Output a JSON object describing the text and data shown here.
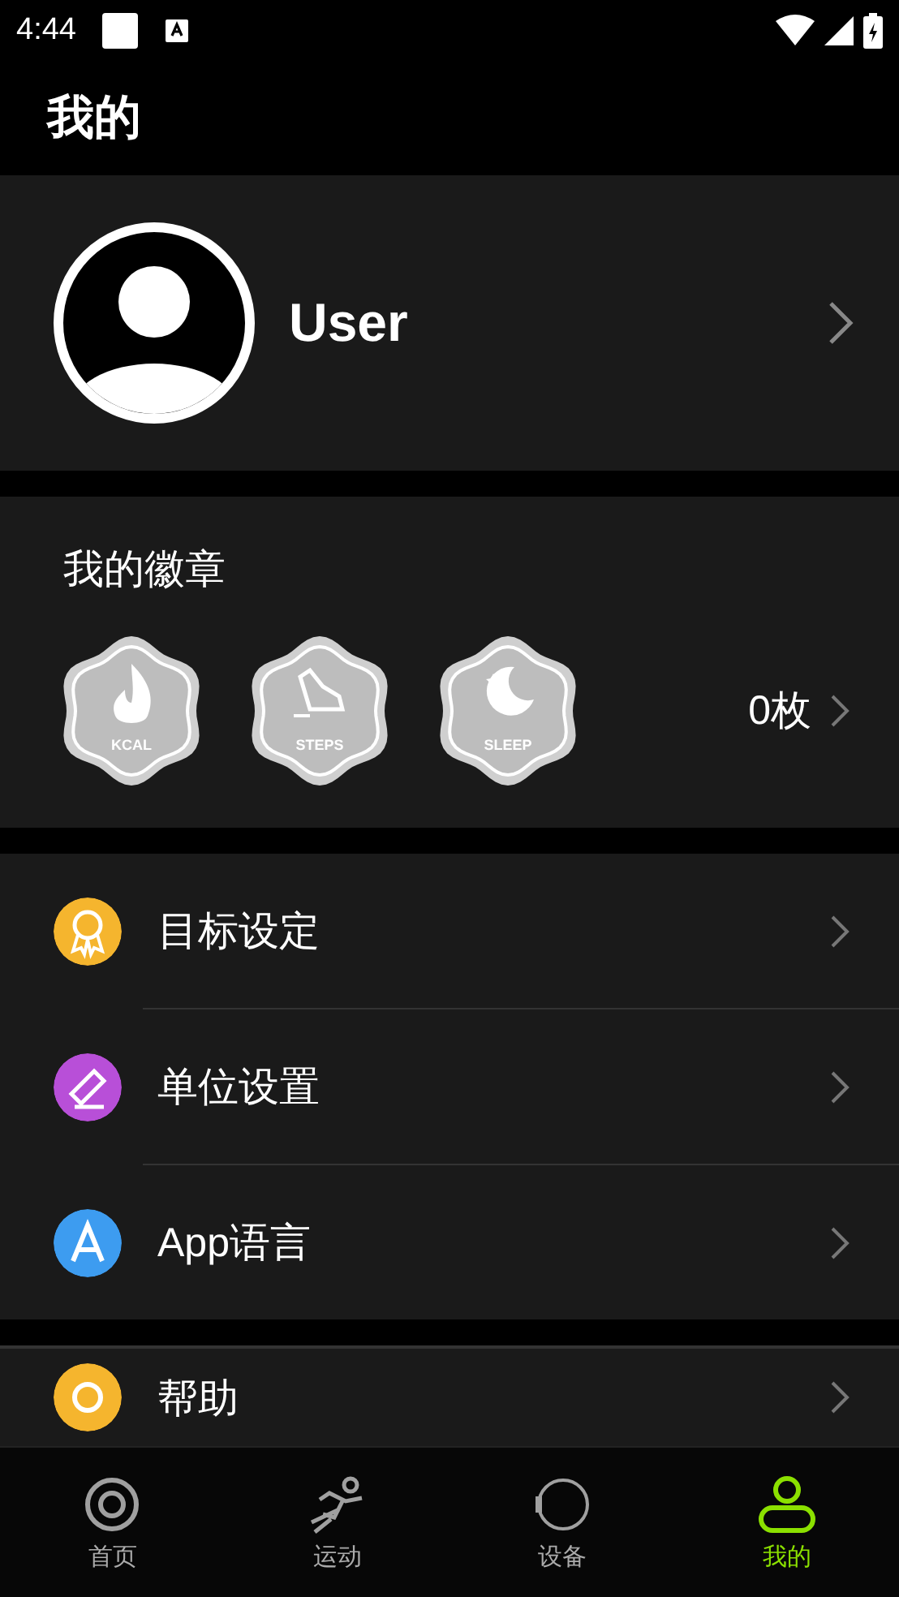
{
  "status_bar": {
    "time": "4:44"
  },
  "header": {
    "title": "我的"
  },
  "profile": {
    "name": "User"
  },
  "badges": {
    "title": "我的徽章",
    "count": "0枚",
    "items": [
      {
        "kind": "kcal",
        "label": "KCAL"
      },
      {
        "kind": "steps",
        "label": "STEPS"
      },
      {
        "kind": "sleep",
        "label": "SLEEP"
      }
    ]
  },
  "menu": [
    {
      "kind": "goal",
      "label": "目标设定",
      "color": "#f5b52e"
    },
    {
      "kind": "unit",
      "label": "单位设置",
      "color": "#b84fd8"
    },
    {
      "kind": "language",
      "label": "App语言",
      "color": "#3d9cf0"
    }
  ],
  "menu_2": [
    {
      "kind": "help",
      "label": "帮助",
      "color": "#f5b52e"
    }
  ],
  "tab_bar": [
    {
      "kind": "home",
      "label": "首页",
      "selected": false
    },
    {
      "kind": "sport",
      "label": "运动",
      "selected": false
    },
    {
      "kind": "device",
      "label": "设备",
      "selected": false
    },
    {
      "kind": "me",
      "label": "我的",
      "selected": true
    }
  ]
}
